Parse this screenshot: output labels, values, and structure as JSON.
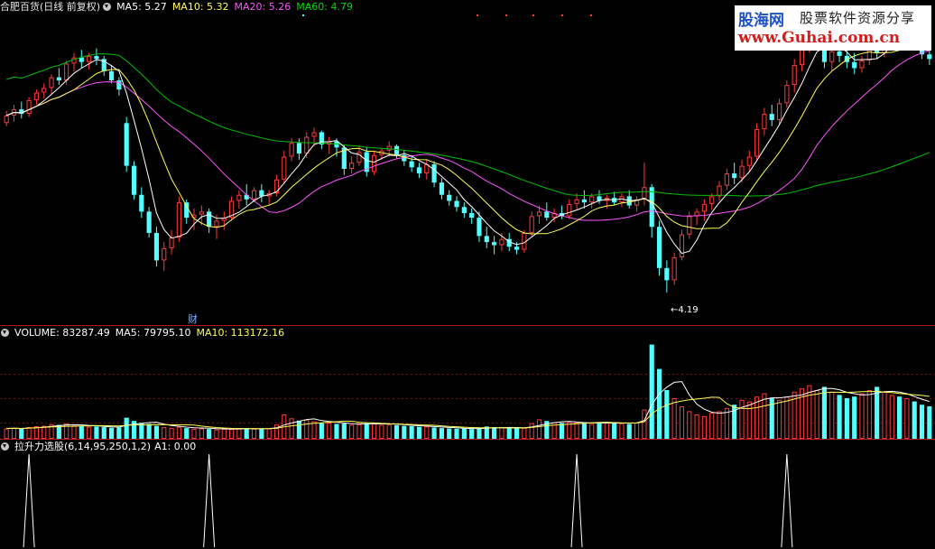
{
  "header": {
    "title": "合肥百货(日线 前复权)",
    "ma5": "MA5: 5.27",
    "ma10": "MA10: 5.32",
    "ma20": "MA20: 5.26",
    "ma60": "MA60: 4.79"
  },
  "volume_header": {
    "label": "VOLUME: 83287.49",
    "ma5": "MA5: 79795.10",
    "ma10": "MA10: 113172.16"
  },
  "indicator_header": {
    "label": "拉升力选股(6,14,95,250,1,2)",
    "a1": "A1: 0.00"
  },
  "annotations": {
    "low_price": "←4.19",
    "finance_marker": "财"
  },
  "watermark": {
    "brand": "股海网",
    "tagline": "股票软件资源分享",
    "url": "www.Guhai.com.cn"
  },
  "colors": {
    "up": "#ff3a3a",
    "down": "#54ffff",
    "ma5": "#ffffff",
    "ma10": "#ffff55",
    "ma20": "#ff55ff",
    "ma60": "#00c000",
    "divider": "#b01818",
    "grid": "#7a1010",
    "indicator": "#ffffff"
  },
  "chart_data": [
    {
      "type": "candlestick",
      "title": "合肥百货(日线 前复权)",
      "ylim": [
        4.0,
        6.0
      ],
      "min_marker": 4.19,
      "series_labels": [
        "MA5: 5.27",
        "MA10: 5.32",
        "MA20: 5.26",
        "MA60: 4.79"
      ],
      "ohlc": [
        [
          5.3,
          5.38,
          5.28,
          5.35
        ],
        [
          5.35,
          5.42,
          5.31,
          5.39
        ],
        [
          5.39,
          5.44,
          5.33,
          5.36
        ],
        [
          5.36,
          5.47,
          5.34,
          5.45
        ],
        [
          5.45,
          5.52,
          5.42,
          5.5
        ],
        [
          5.5,
          5.56,
          5.46,
          5.53
        ],
        [
          5.53,
          5.62,
          5.49,
          5.6
        ],
        [
          5.6,
          5.66,
          5.55,
          5.58
        ],
        [
          5.58,
          5.71,
          5.55,
          5.69
        ],
        [
          5.69,
          5.76,
          5.64,
          5.73
        ],
        [
          5.73,
          5.78,
          5.66,
          5.7
        ],
        [
          5.7,
          5.76,
          5.65,
          5.74
        ],
        [
          5.74,
          5.79,
          5.68,
          5.72
        ],
        [
          5.72,
          5.74,
          5.61,
          5.64
        ],
        [
          5.64,
          5.68,
          5.56,
          5.58
        ],
        [
          5.58,
          5.6,
          5.48,
          5.52
        ],
        [
          5.3,
          5.34,
          4.98,
          5.02
        ],
        [
          5.02,
          5.05,
          4.8,
          4.83
        ],
        [
          4.83,
          4.88,
          4.68,
          4.72
        ],
        [
          4.72,
          4.75,
          4.55,
          4.58
        ],
        [
          4.58,
          4.62,
          4.36,
          4.4
        ],
        [
          4.4,
          4.52,
          4.33,
          4.48
        ],
        [
          4.48,
          4.6,
          4.44,
          4.55
        ],
        [
          4.55,
          4.82,
          4.52,
          4.78
        ],
        [
          4.78,
          4.8,
          4.64,
          4.68
        ],
        [
          4.68,
          4.74,
          4.6,
          4.7
        ],
        [
          4.7,
          4.76,
          4.63,
          4.72
        ],
        [
          4.72,
          4.74,
          4.58,
          4.62
        ],
        [
          4.62,
          4.7,
          4.54,
          4.66
        ],
        [
          4.66,
          4.72,
          4.6,
          4.68
        ],
        [
          4.68,
          4.82,
          4.66,
          4.79
        ],
        [
          4.79,
          4.86,
          4.74,
          4.83
        ],
        [
          4.83,
          4.9,
          4.76,
          4.8
        ],
        [
          4.8,
          4.88,
          4.78,
          4.86
        ],
        [
          4.86,
          4.9,
          4.78,
          4.82
        ],
        [
          4.82,
          4.86,
          4.76,
          4.84
        ],
        [
          4.84,
          4.96,
          4.82,
          4.93
        ],
        [
          4.93,
          5.12,
          4.9,
          5.08
        ],
        [
          5.08,
          5.2,
          5.05,
          5.17
        ],
        [
          5.17,
          5.2,
          5.06,
          5.1
        ],
        [
          5.1,
          5.24,
          5.07,
          5.21
        ],
        [
          5.21,
          5.27,
          5.15,
          5.24
        ],
        [
          5.24,
          5.25,
          5.13,
          5.16
        ],
        [
          5.16,
          5.21,
          5.1,
          5.18
        ],
        [
          5.18,
          5.2,
          5.08,
          5.14
        ],
        [
          5.14,
          5.16,
          4.96,
          5.0
        ],
        [
          5.0,
          5.08,
          4.97,
          5.04
        ],
        [
          5.04,
          5.15,
          5.02,
          5.11
        ],
        [
          5.11,
          5.14,
          4.95,
          4.98
        ],
        [
          4.98,
          5.12,
          4.96,
          5.09
        ],
        [
          5.09,
          5.14,
          5.06,
          5.12
        ],
        [
          5.12,
          5.18,
          5.08,
          5.15
        ],
        [
          5.15,
          5.16,
          5.07,
          5.09
        ],
        [
          5.09,
          5.12,
          5.02,
          5.05
        ],
        [
          5.05,
          5.08,
          4.98,
          5.01
        ],
        [
          5.01,
          5.04,
          4.94,
          4.97
        ],
        [
          4.97,
          5.06,
          4.93,
          5.03
        ],
        [
          5.03,
          5.05,
          4.88,
          4.91
        ],
        [
          4.91,
          4.94,
          4.8,
          4.83
        ],
        [
          4.83,
          4.86,
          4.76,
          4.79
        ],
        [
          4.79,
          4.82,
          4.72,
          4.75
        ],
        [
          4.75,
          4.78,
          4.68,
          4.71
        ],
        [
          4.71,
          4.74,
          4.64,
          4.68
        ],
        [
          4.68,
          4.72,
          4.52,
          4.56
        ],
        [
          4.56,
          4.62,
          4.48,
          4.52
        ],
        [
          4.52,
          4.56,
          4.44,
          4.5
        ],
        [
          4.5,
          4.58,
          4.46,
          4.54
        ],
        [
          4.54,
          4.58,
          4.46,
          4.49
        ],
        [
          4.49,
          4.52,
          4.44,
          4.47
        ],
        [
          4.47,
          4.6,
          4.45,
          4.58
        ],
        [
          4.58,
          4.72,
          4.55,
          4.69
        ],
        [
          4.69,
          4.76,
          4.64,
          4.72
        ],
        [
          4.72,
          4.78,
          4.66,
          4.68
        ],
        [
          4.68,
          4.74,
          4.65,
          4.71
        ],
        [
          4.71,
          4.76,
          4.67,
          4.69
        ],
        [
          4.69,
          4.8,
          4.67,
          4.77
        ],
        [
          4.77,
          4.84,
          4.73,
          4.8
        ],
        [
          4.8,
          4.86,
          4.74,
          4.78
        ],
        [
          4.78,
          4.84,
          4.74,
          4.82
        ],
        [
          4.82,
          4.86,
          4.77,
          4.79
        ],
        [
          4.79,
          4.83,
          4.74,
          4.81
        ],
        [
          4.81,
          4.85,
          4.76,
          4.78
        ],
        [
          4.78,
          4.84,
          4.75,
          4.82
        ],
        [
          4.82,
          4.86,
          4.74,
          4.76
        ],
        [
          4.76,
          4.82,
          4.72,
          4.8
        ],
        [
          4.8,
          5.04,
          4.76,
          4.88
        ],
        [
          4.88,
          4.9,
          4.55,
          4.62
        ],
        [
          4.62,
          4.66,
          4.3,
          4.35
        ],
        [
          4.35,
          4.4,
          4.19,
          4.27
        ],
        [
          4.27,
          4.45,
          4.24,
          4.42
        ],
        [
          4.42,
          4.6,
          4.4,
          4.57
        ],
        [
          4.57,
          4.72,
          4.54,
          4.69
        ],
        [
          4.69,
          4.74,
          4.63,
          4.72
        ],
        [
          4.72,
          4.8,
          4.66,
          4.77
        ],
        [
          4.77,
          4.84,
          4.73,
          4.82
        ],
        [
          4.82,
          4.92,
          4.79,
          4.89
        ],
        [
          4.89,
          5.0,
          4.86,
          4.97
        ],
        [
          4.97,
          5.04,
          4.9,
          4.94
        ],
        [
          4.94,
          5.06,
          4.91,
          5.02
        ],
        [
          5.02,
          5.12,
          4.98,
          5.08
        ],
        [
          5.08,
          5.3,
          5.05,
          5.26
        ],
        [
          5.26,
          5.4,
          5.22,
          5.36
        ],
        [
          5.36,
          5.42,
          5.28,
          5.32
        ],
        [
          5.32,
          5.46,
          5.29,
          5.43
        ],
        [
          5.43,
          5.58,
          5.4,
          5.55
        ],
        [
          5.55,
          5.72,
          5.5,
          5.68
        ],
        [
          5.68,
          5.86,
          5.64,
          5.82
        ],
        [
          5.82,
          5.9,
          5.76,
          5.86
        ],
        [
          5.86,
          5.96,
          5.8,
          5.92
        ],
        [
          5.92,
          5.94,
          5.66,
          5.7
        ],
        [
          5.7,
          5.8,
          5.64,
          5.77
        ],
        [
          5.77,
          5.84,
          5.7,
          5.74
        ],
        [
          5.74,
          5.82,
          5.66,
          5.7
        ],
        [
          5.7,
          5.76,
          5.62,
          5.66
        ],
        [
          5.66,
          5.74,
          5.63,
          5.71
        ],
        [
          5.71,
          5.8,
          5.68,
          5.78
        ],
        [
          5.78,
          5.84,
          5.72,
          5.76
        ],
        [
          5.76,
          5.9,
          5.73,
          5.87
        ],
        [
          5.87,
          5.98,
          5.84,
          5.95
        ],
        [
          5.95,
          5.98,
          5.8,
          5.83
        ],
        [
          5.83,
          5.92,
          5.8,
          5.89
        ],
        [
          5.89,
          5.95,
          5.82,
          5.85
        ],
        [
          5.85,
          5.88,
          5.72,
          5.75
        ],
        [
          5.75,
          5.8,
          5.68,
          5.72
        ]
      ]
    },
    {
      "type": "bar",
      "title": "VOLUME",
      "series_labels": [
        "VOLUME: 83287.49",
        "MA5: 79795.10",
        "MA10: 113172.16"
      ],
      "values": [
        64000,
        66000,
        62000,
        72000,
        78000,
        80000,
        90000,
        86000,
        95000,
        82000,
        78000,
        74000,
        76000,
        72000,
        68000,
        70000,
        130000,
        110000,
        98000,
        92000,
        80000,
        72000,
        68000,
        74000,
        66000,
        62000,
        64000,
        60000,
        58000,
        62000,
        60000,
        64000,
        66000,
        62000,
        60000,
        64000,
        88000,
        150000,
        126000,
        112000,
        118000,
        108000,
        96000,
        100000,
        92000,
        94000,
        86000,
        90000,
        96000,
        100000,
        86000,
        88000,
        84000,
        80000,
        78000,
        74000,
        76000,
        70000,
        66000,
        64000,
        62000,
        64000,
        60000,
        66000,
        76000,
        72000,
        70000,
        66000,
        64000,
        68000,
        96000,
        120000,
        110000,
        102000,
        98000,
        106000,
        100000,
        94000,
        92000,
        96000,
        104000,
        98000,
        96000,
        92000,
        100000,
        180000,
        580000,
        430000,
        300000,
        250000,
        200000,
        170000,
        150000,
        140000,
        160000,
        170000,
        190000,
        210000,
        240000,
        230000,
        260000,
        280000,
        250000,
        240000,
        260000,
        290000,
        310000,
        330000,
        300000,
        320000,
        290000,
        270000,
        250000,
        260000,
        280000,
        300000,
        320000,
        290000,
        270000,
        260000,
        250000,
        230000,
        210000,
        200000
      ],
      "ylim": [
        0,
        600000
      ]
    },
    {
      "type": "line",
      "title": "拉升力选股(6,14,95,250,1,2)",
      "series_labels": [
        "A1: 0.00"
      ],
      "signal_bars": [
        3,
        27,
        76,
        104
      ],
      "values_note_free": true,
      "ylim": [
        0,
        1
      ]
    }
  ]
}
